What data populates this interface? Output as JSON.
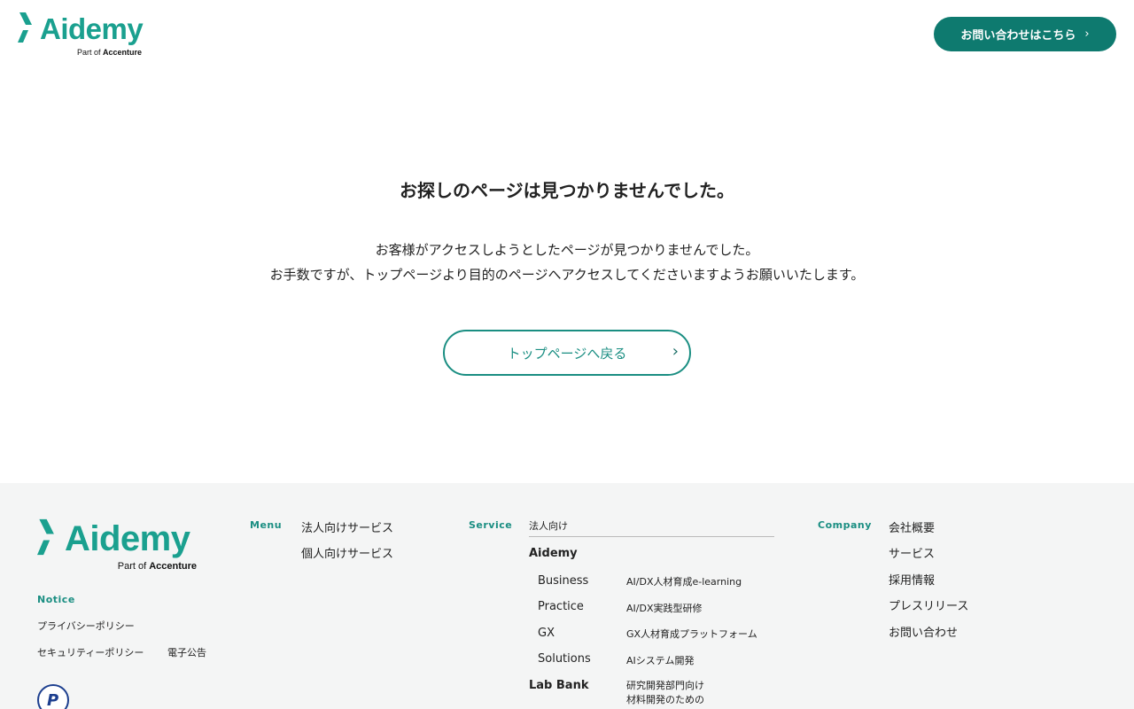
{
  "header": {
    "logo_text": "Aidemy",
    "logo_sub_prefix": "Part of ",
    "logo_sub_brand": "Accenture",
    "contact_label": "お問い合わせはこちら",
    "contact_chevron": "›"
  },
  "main": {
    "title": "お探しのページは見つかりませんでした。",
    "desc_line1": "お客様がアクセスしようとしたページが見つかりませんでした。",
    "desc_line2": "お手数ですが、トップページより目的のページへアクセスしてくださいますようお願いいたします。",
    "back_label": "トップページへ戻る",
    "back_chevron": "›"
  },
  "footer": {
    "logo_text": "Aidemy",
    "logo_sub_prefix": "Part of ",
    "logo_sub_brand": "Accenture",
    "notice_label": "Notice",
    "notice_links": [
      "プライバシーポリシー",
      "セキュリティーポリシー",
      "電子公告"
    ],
    "menu_label": "Menu",
    "menu_links": [
      "法人向けサービス",
      "個人向けサービス"
    ],
    "service_label": "Service",
    "service_category": "法人向け",
    "aidemy_heading": "Aidemy",
    "services": [
      {
        "name": "Business",
        "desc": "AI/DX人材育成e-learning"
      },
      {
        "name": "Practice",
        "desc": "AI/DX実践型研修"
      },
      {
        "name": "GX",
        "desc": "GX人材育成プラットフォーム"
      },
      {
        "name": "Solutions",
        "desc": "AIシステム開発"
      }
    ],
    "labbank_heading": "Lab Bank",
    "labbank_desc1": "研究開発部門向け",
    "labbank_desc2": "材料開発のための",
    "company_label": "Company",
    "company_links": [
      "会社概要",
      "サービス",
      "採用情報",
      "プレスリリース",
      "お問い合わせ"
    ],
    "badge_letter": "P"
  },
  "colors": {
    "brand": "#1aa08f",
    "brand_dark": "#0e7a6f",
    "footer_bg": "#f4f5f5"
  }
}
